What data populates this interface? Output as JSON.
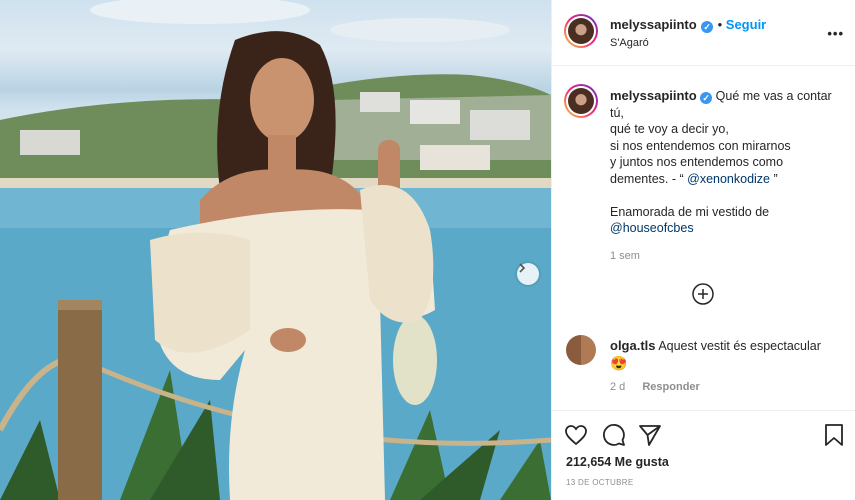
{
  "post": {
    "username": "melyssapiinto",
    "follow_label": "Seguir",
    "location": "S'Agaró",
    "more_label": "•••",
    "caption_username": "melyssapiinto",
    "caption_text_1": "Qué me vas a contar tú,\nqué te voy a decir yo,\nsi nos entendemos con mirarnos\ny juntos nos entendemos como dementes. - “ ",
    "caption_mention_1": "@xenonkodize",
    "caption_text_2": " ”\n\nEnamorada de mi vestido de\n",
    "caption_mention_2": "@houseofcbes",
    "caption_time": "1 sem",
    "likes": "212,654 Me gusta",
    "date": "13 DE OCTUBRE"
  },
  "comment": {
    "username": "olga.tls",
    "text": "Aquest vestit és espectacular",
    "emoji": "😍",
    "time": "2 d",
    "reply_label": "Responder"
  },
  "icons": {
    "verified": "verified-badge-icon",
    "like": "heart-icon",
    "comment": "comment-icon",
    "share": "paper-plane-icon",
    "save": "bookmark-icon",
    "more_comments": "plus-circle-icon",
    "next": "chevron-right-icon"
  },
  "colors": {
    "link": "#00376b",
    "follow": "#0095f6",
    "muted": "#8e8e8e",
    "verified": "#3897f0"
  }
}
